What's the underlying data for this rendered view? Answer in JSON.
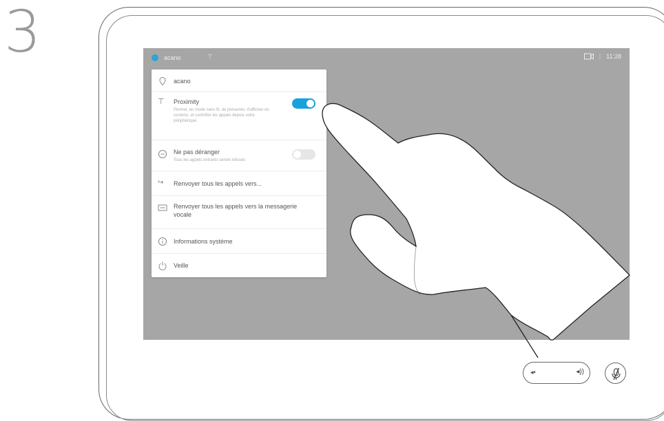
{
  "step": {
    "number": "3"
  },
  "status_bar": {
    "name": "acano",
    "time": "11:28",
    "separator": "|"
  },
  "menu": {
    "items": [
      {
        "label": "acano",
        "icon": "location-pin-icon"
      },
      {
        "label": "Proximity",
        "description": "Permet, en mode sans fil, de présenter, d'afficher du contenu, et contrôler les appels depuis votre périphérique",
        "icon": "proximity-icon",
        "toggle": "on"
      },
      {
        "label": "Ne pas déranger",
        "description": "Tous les appels entrants seront refusés",
        "icon": "do-not-disturb-icon",
        "toggle": "off"
      },
      {
        "label": "Renvoyer tous les appels vers...",
        "icon": "call-forward-icon"
      },
      {
        "label": "Renvoyer tous les appels vers la messagerie vocale",
        "icon": "voicemail-icon"
      },
      {
        "label": "Informations système",
        "icon": "info-icon"
      },
      {
        "label": "Veille",
        "icon": "power-icon"
      }
    ]
  },
  "colors": {
    "accent": "#18a2dd",
    "screen_background": "#a6a6a6",
    "menu_background": "#ffffff"
  }
}
